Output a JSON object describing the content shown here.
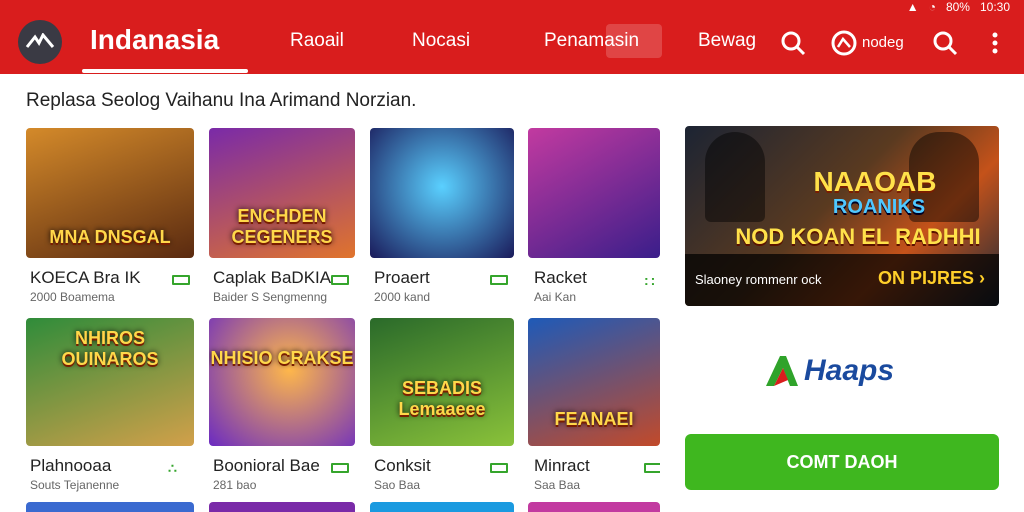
{
  "statusbar": {
    "battery": "80%",
    "time": "10:30"
  },
  "header": {
    "title": "Indanasia",
    "nav": [
      "Raoail",
      "Nocasi",
      "Penamasin",
      "Bewag"
    ],
    "user_label": "nodeg"
  },
  "subtitle": "Replasa Seolog Vaihanu Ina Arimand Norzian.",
  "games": [
    {
      "name": "KOECA Bra IK",
      "meta": "2000 Boamema",
      "thumb_text": "MNA DNSGAL",
      "bg": [
        "#d48a2a",
        "#5a2a10"
      ]
    },
    {
      "name": "Caplak BaDKIA",
      "meta": "Baider S Sengmenng",
      "thumb_text": "ENCHDEN CEGENERS",
      "bg": [
        "#7a2aa8",
        "#e0742c"
      ]
    },
    {
      "name": "Proaert",
      "meta": "2000 kand",
      "thumb_text": "",
      "bg": [
        "#2a9ae0",
        "#1a1a5a"
      ]
    },
    {
      "name": "Racket",
      "meta": "Aai Kan",
      "thumb_text": "",
      "bg": [
        "#c23aa0",
        "#3a1e8a"
      ]
    },
    {
      "name": "Plahnooaa",
      "meta": "Souts Tejanenne",
      "thumb_text": "NHIROS OUINAROS",
      "bg": [
        "#2f8c3a",
        "#d2a04a"
      ]
    },
    {
      "name": "Boonioral Bae",
      "meta": "281 bao",
      "thumb_text": "NHISIO CRAKSE",
      "bg": [
        "#e07a1c",
        "#6a2ac2"
      ]
    },
    {
      "name": "Conksit",
      "meta": "Sao Baa",
      "thumb_text": "SEBADIS Lemaaeee",
      "bg": [
        "#2a6a2a",
        "#8ac23a"
      ]
    },
    {
      "name": "Minract",
      "meta": "Saa Baa",
      "thumb_text": "FEANAEI",
      "bg": [
        "#1e5ab8",
        "#c24a2a"
      ]
    }
  ],
  "featured": {
    "title": "NAAOAB",
    "subtitle": "ROANIKS",
    "headline": "NOD KOAN EL RADHHI",
    "caption": "Slaoney rommenr ock",
    "cta": "ON PIJRES ›"
  },
  "brand": {
    "name": "Haaps"
  },
  "install_button": "COMT DAOH",
  "colors": {
    "accent": "#d91d1d",
    "green": "#3fb71f"
  },
  "icons": [
    "logo-icon",
    "search-icon",
    "user-logo-icon",
    "more-icon"
  ]
}
